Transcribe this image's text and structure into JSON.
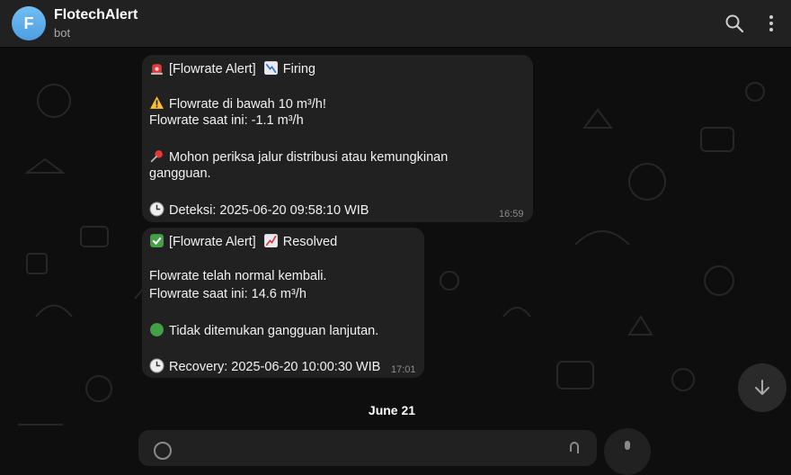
{
  "header": {
    "avatar_letter": "F",
    "title": "FlotechAlert",
    "subtitle": "bot",
    "icons": [
      "search-icon",
      "more-vertical-icon"
    ]
  },
  "messages": [
    {
      "lines": [
        {
          "emoji": "siren",
          "text": "[Flowrate Alert]"
        },
        {
          "emoji": "chart-decreasing",
          "text": "Firing"
        },
        {
          "emoji": "warning",
          "text": "Flowrate di bawah 10 m³/h!"
        },
        {
          "text": "Flowrate saat ini: -1.1 m³/h"
        },
        {
          "emoji": "pushpin",
          "text": "Mohon periksa jalur distribusi atau kemungkinan"
        },
        {
          "text": "gangguan."
        },
        {
          "emoji": "clock",
          "text": "Deteksi: 2025-06-20 09:58:10 WIB"
        }
      ],
      "time": "16:59"
    },
    {
      "lines": [
        {
          "emoji": "check-mark",
          "text": "[Flowrate Alert]"
        },
        {
          "emoji": "chart-increasing",
          "text": "Resolved"
        },
        {
          "text": "Flowrate telah normal kembali."
        },
        {
          "text": "Flowrate saat ini: 14.6 m³/h"
        },
        {
          "emoji": "green-circle",
          "text": "Tidak ditemukan gangguan lanjutan."
        },
        {
          "emoji": "clock",
          "text": "Recovery: 2025-06-20 10:00:30 WIB"
        }
      ],
      "time": "17:01"
    }
  ],
  "date_separator": "June 21",
  "colors": {
    "header_bg": "#212121",
    "bubble_bg": "#212121",
    "chat_bg": "#0e0e0e",
    "avatar": "#5ba8e8"
  }
}
